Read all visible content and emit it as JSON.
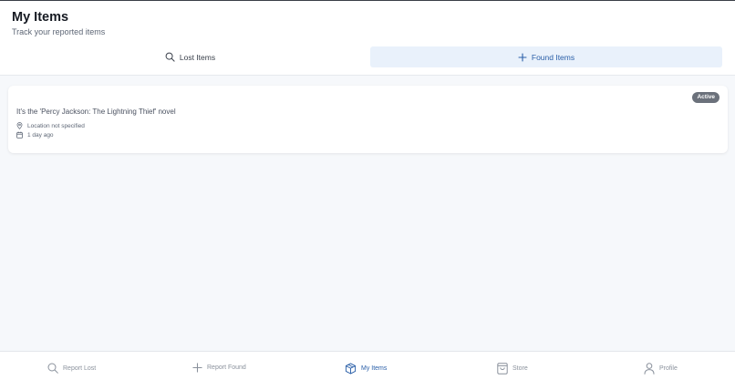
{
  "header": {
    "title": "My Items",
    "subtitle": "Track your reported items"
  },
  "tabs": [
    {
      "label": "Lost Items",
      "icon": "search-icon",
      "active": false
    },
    {
      "label": "Found Items",
      "icon": "plus-icon",
      "active": true
    }
  ],
  "items": [
    {
      "title": "It's the 'Percy Jackson: The Lightning Thief' novel",
      "status": "Active",
      "location": "Location not specified",
      "date": "1 day ago"
    }
  ],
  "bottom_nav": [
    {
      "label": "Report Lost",
      "icon": "search-icon",
      "active": false
    },
    {
      "label": "Report Found",
      "icon": "plus-icon",
      "active": false
    },
    {
      "label": "My Items",
      "icon": "box-icon",
      "active": true
    },
    {
      "label": "Store",
      "icon": "shopping-bag-icon",
      "active": false
    },
    {
      "label": "Profile",
      "icon": "user-icon",
      "active": false
    }
  ],
  "colors": {
    "accent": "#2a5fa8",
    "active_tab_bg": "#e9f1fb",
    "badge_bg": "#6b717b",
    "page_bg": "#f6f8fb"
  }
}
